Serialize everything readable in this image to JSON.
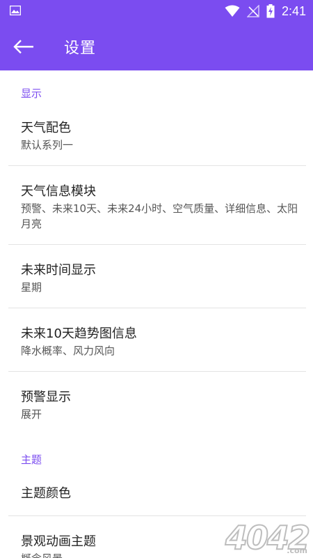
{
  "status_bar": {
    "time": "2:41"
  },
  "app_bar": {
    "title": "设置"
  },
  "sections": [
    {
      "header": "显示",
      "items": [
        {
          "title": "天气配色",
          "subtitle": "默认系列一"
        },
        {
          "title": "天气信息模块",
          "subtitle": "预警、未来10天、未来24小时、空气质量、详细信息、太阳月亮"
        },
        {
          "title": "未来时间显示",
          "subtitle": "星期"
        },
        {
          "title": "未来10天趋势图信息",
          "subtitle": "降水概率、风力风向"
        },
        {
          "title": "预警显示",
          "subtitle": "展开"
        }
      ]
    },
    {
      "header": "主题",
      "items": [
        {
          "title": "主题颜色",
          "subtitle": ""
        },
        {
          "title": "景观动画主题",
          "subtitle": "概念风景"
        }
      ]
    }
  ],
  "watermark": {
    "text": "4042",
    "suffix": ".com"
  },
  "colors": {
    "accent": "#7b4cf0",
    "section_header": "#7b4cf0",
    "title_text": "#222222",
    "subtitle_text": "#555555",
    "divider": "#e3e3e3"
  },
  "icons": {
    "status_left": "image-icon",
    "wifi": "wifi-icon",
    "signal": "no-signal-icon",
    "battery": "battery-charging-icon",
    "back": "arrow-left-icon"
  }
}
